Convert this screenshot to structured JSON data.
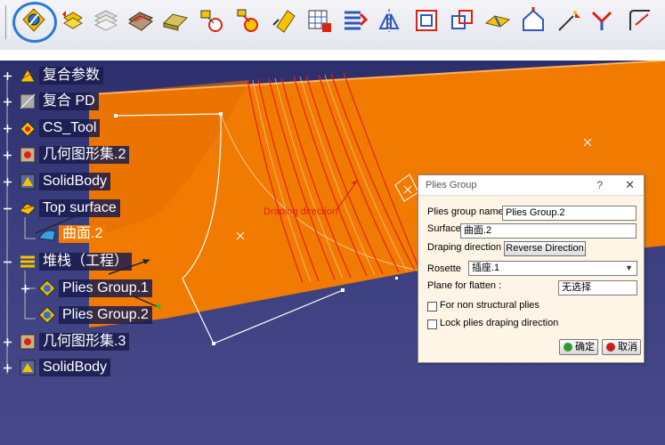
{
  "toolbar": {
    "buttons": [
      {
        "name": "plies-group-icon"
      },
      {
        "name": "exchange-plies-icon"
      },
      {
        "name": "plies-table-icon"
      },
      {
        "name": "core-sampling-icon"
      },
      {
        "name": "solid-slice-icon"
      },
      {
        "name": "plies-from-3d-icon"
      },
      {
        "name": "ply-exploder-icon"
      },
      {
        "name": "material-excess-icon"
      },
      {
        "name": "grid-panel-icon"
      },
      {
        "name": "stacking-icon"
      },
      {
        "name": "symmetry-icon"
      },
      {
        "name": "grid-icon"
      },
      {
        "name": "zone-icon"
      },
      {
        "name": "transition-icon"
      },
      {
        "name": "virtual-stacking-icon"
      },
      {
        "name": "solid-ply-icon"
      },
      {
        "name": "flatten-icon"
      },
      {
        "name": "producibility-icon"
      },
      {
        "name": "rosette-icon"
      }
    ]
  },
  "tree": {
    "nodes": [
      {
        "label": "复合参数",
        "icon": "composites-parameters-icon"
      },
      {
        "label": "复合 PD",
        "icon": "composites-pd-icon"
      },
      {
        "label": "CS_Tool",
        "icon": "cs-tool-icon"
      },
      {
        "label": "几何图形集.2",
        "icon": "geometrical-set-icon"
      },
      {
        "label": "SolidBody",
        "icon": "solid-body-icon"
      },
      {
        "label": "Top surface",
        "icon": "top-surface-icon"
      },
      {
        "label": "曲面.2",
        "icon": "surface-icon"
      },
      {
        "label": "堆栈（工程）",
        "icon": "stacking-icon"
      },
      {
        "label": "Plies Group.1",
        "icon": "plies-group-icon"
      },
      {
        "label": "Plies Group.2",
        "icon": "plies-group-icon"
      },
      {
        "label": "几何图形集.3",
        "icon": "geometrical-set-icon"
      },
      {
        "label": "SolidBody",
        "icon": "solid-body-icon"
      }
    ]
  },
  "viewport": {
    "draping_label": "Draping direction",
    "surface_color": "#f07b00",
    "draping_color": "#e2231a"
  },
  "dialog": {
    "title": "Plies Group",
    "help": "?",
    "close": "✕",
    "plies_group_name_label": "Plies group name",
    "plies_group_name_value": "Plies Group.2",
    "surface_label": "Surface",
    "surface_value": "曲面.2",
    "draping_direction_label": "Draping direction",
    "reverse_direction_button": "Reverse Direction",
    "rosette_label": "Rosette",
    "rosette_value": "插座.1",
    "plane_for_flatten_label": "Plane for flatten :",
    "plane_for_flatten_value": "无选择",
    "non_structural_label": "For non structural plies",
    "non_structural_checked": false,
    "lock_draping_label": "Lock plies draping direction",
    "lock_draping_checked": false,
    "ok_label": "确定",
    "cancel_label": "取消",
    "ok_color": "#2e9a2e",
    "cancel_color": "#c81e1e"
  }
}
